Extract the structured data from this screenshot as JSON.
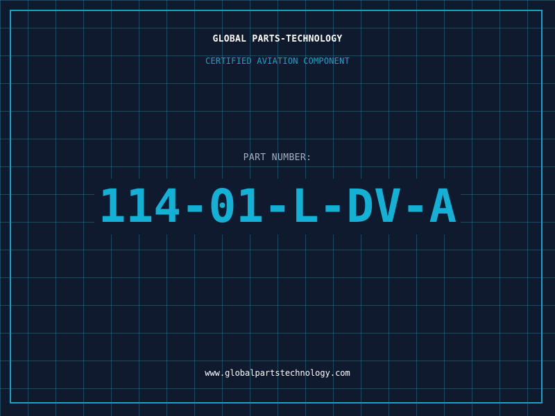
{
  "header": {
    "company": "GLOBAL PARTS-TECHNOLOGY",
    "subtitle": "CERTIFIED AVIATION COMPONENT"
  },
  "part": {
    "label": "PART NUMBER:",
    "number": "114-01-L-DV-A"
  },
  "footer": {
    "website": "www.globalpartstechnology.com"
  },
  "colors": {
    "background": "#101a2e",
    "accent": "#13b1d6",
    "grid": "#288ca5",
    "text_primary": "#ffffff",
    "text_muted": "#a7b0c4"
  }
}
